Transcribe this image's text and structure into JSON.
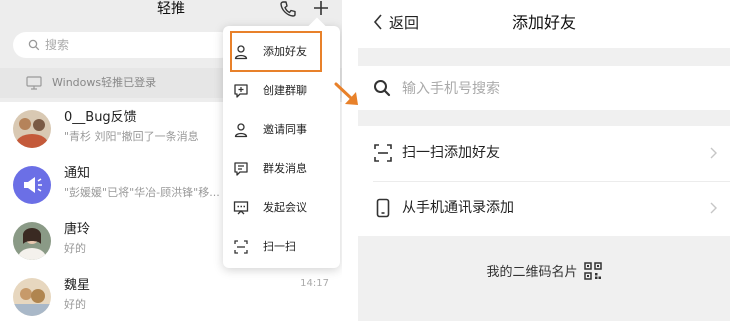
{
  "left": {
    "title": "轻推",
    "search_placeholder": "搜索",
    "windows_login_text": "Windows轻推已登录",
    "chats": [
      {
        "name": "0__Bug反馈",
        "message": "\"青杉 刘阳\"撤回了一条消息",
        "time": ""
      },
      {
        "name": "通知",
        "message": "\"彭媛媛\"已将\"华冶-顾洪锋\"移...",
        "time": ""
      },
      {
        "name": "唐玲",
        "message": "好的",
        "time": ""
      },
      {
        "name": "魏星",
        "message": "好的",
        "time": "14:17"
      }
    ],
    "popup_menu": [
      {
        "label": "添加好友",
        "icon": "person-icon"
      },
      {
        "label": "创建群聊",
        "icon": "chat-plus-icon"
      },
      {
        "label": "邀请同事",
        "icon": "person-icon"
      },
      {
        "label": "群发消息",
        "icon": "broadcast-icon"
      },
      {
        "label": "发起会议",
        "icon": "meeting-icon"
      },
      {
        "label": "扫一扫",
        "icon": "scan-icon"
      }
    ]
  },
  "right": {
    "back_label": "返回",
    "title": "添加好友",
    "search_placeholder": "输入手机号搜索",
    "options": [
      {
        "label": "扫一扫添加好友",
        "icon": "scan-icon"
      },
      {
        "label": "从手机通讯录添加",
        "icon": "phone-icon"
      }
    ],
    "qr_label": "我的二维码名片"
  },
  "colors": {
    "highlight": "#e8812a",
    "notice_avatar": "#6b6fe6"
  }
}
